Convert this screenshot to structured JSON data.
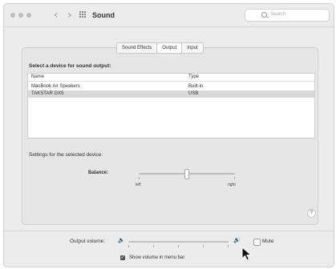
{
  "window": {
    "title": "Sound",
    "search_placeholder": "Search",
    "back_glyph": "‹",
    "forward_glyph": "›"
  },
  "tabs": [
    {
      "label": "Sound Effects",
      "active": false
    },
    {
      "label": "Output",
      "active": true
    },
    {
      "label": "Input",
      "active": false
    }
  ],
  "output": {
    "prompt": "Select a device for sound output:",
    "columns": {
      "name": "Name",
      "type": "Type"
    },
    "devices": [
      {
        "name": "MacBook Air Speakers",
        "type": "Built-in",
        "selected": false
      },
      {
        "name": "TAKSTAR GX5",
        "type": "USB",
        "selected": true
      }
    ],
    "settings_label": "Settings for the selected device:",
    "balance": {
      "label": "Balance:",
      "left_label": "left",
      "right_label": "right",
      "value_fraction": 0.52
    },
    "help_label": "?"
  },
  "footer": {
    "output_volume_label": "Output volume:",
    "volume_fraction": 1.0,
    "mute_label": "Mute",
    "mute_checked": false,
    "show_in_menu_bar_label": "Show volume in menu bar",
    "show_in_menu_bar_checked": true
  },
  "icons": {
    "speaker_low": "🔈",
    "speaker_high": "🔊",
    "checkmark": "✓"
  }
}
